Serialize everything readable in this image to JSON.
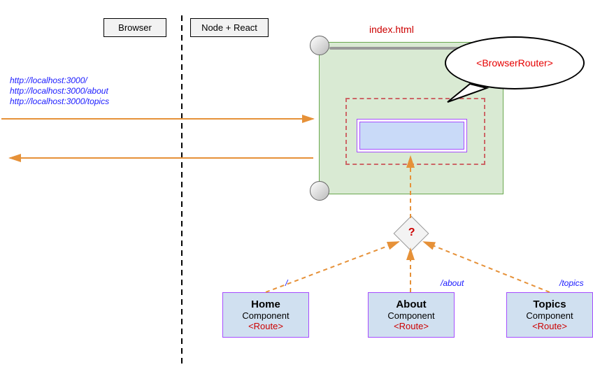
{
  "labels": {
    "browser": "Browser",
    "nodeReact": "Node + React",
    "indexHtml": "index.html",
    "browserRouter": "<BrowserRouter>",
    "decision": "?"
  },
  "urls": [
    "http://localhost:3000/",
    "http://localhost:3000/about",
    "http://localhost:3000/topics"
  ],
  "paths": {
    "home": "/",
    "about": "/about",
    "topics": "/topics"
  },
  "components": {
    "home": {
      "title": "Home",
      "sub": "Component",
      "route": "<Route>"
    },
    "about": {
      "title": "About",
      "sub": "Component",
      "route": "<Route>"
    },
    "topics": {
      "title": "Topics",
      "sub": "Component",
      "route": "<Route>"
    }
  }
}
